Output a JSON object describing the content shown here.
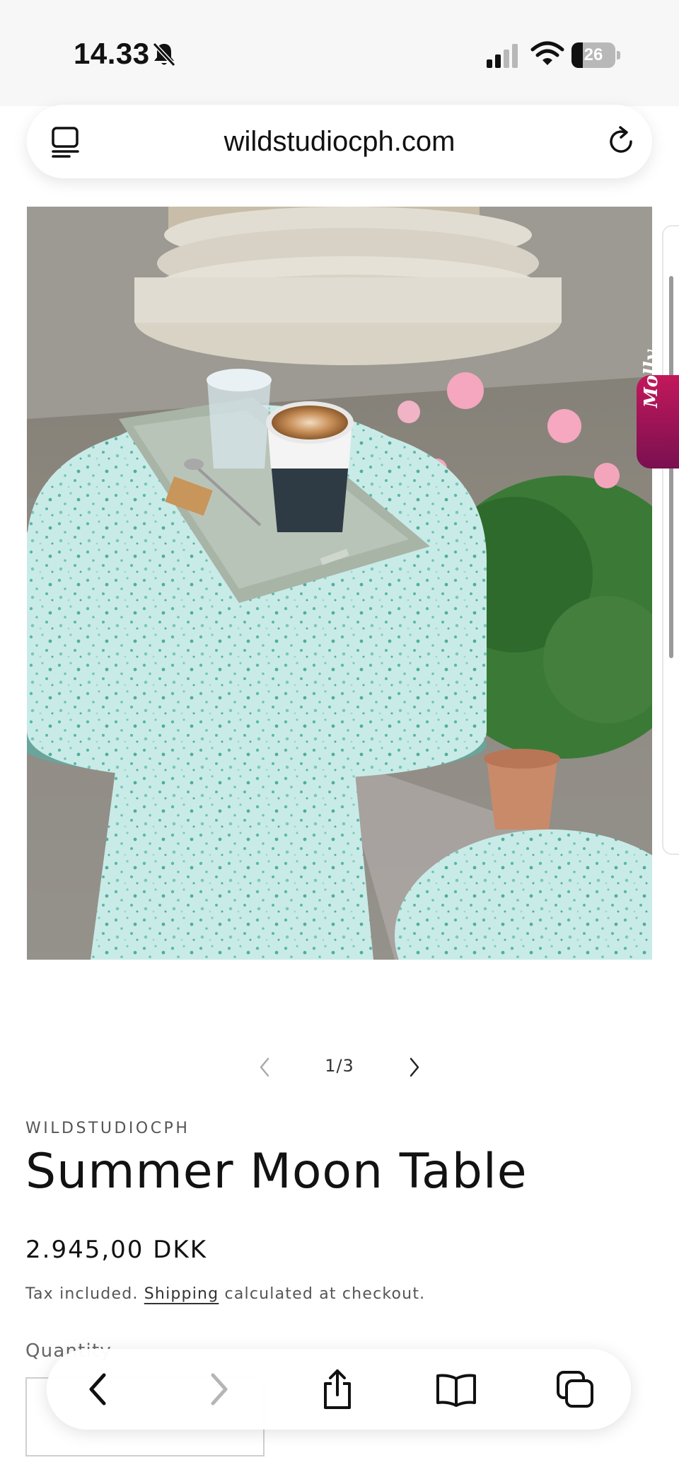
{
  "status_bar": {
    "time": "14.33",
    "battery_level": "26",
    "battery_fraction": 0.26,
    "icons": [
      "bell-slash-icon",
      "cellular-signal-icon",
      "wifi-icon",
      "battery-icon"
    ]
  },
  "browser": {
    "url": "wildstudiocph.com",
    "icons": [
      "reader-mode-icon",
      "reload-icon"
    ]
  },
  "side_widget": {
    "label": "Molly",
    "color": "#c2185b"
  },
  "gallery": {
    "counter": "1/3",
    "icons": [
      "chevron-left-icon",
      "chevron-right-icon"
    ]
  },
  "product": {
    "vendor": "WILDSTUDIOCPH",
    "title": "Summer Moon Table",
    "price": "2.945,00 DKK",
    "tax_prefix": "Tax included.",
    "shipping_link": "Shipping",
    "tax_suffix": "calculated at checkout.",
    "quantity_label": "Quantity"
  },
  "toolbar": {
    "icons": [
      "back-icon",
      "forward-icon",
      "share-icon",
      "bookmarks-icon",
      "tabs-icon"
    ]
  }
}
